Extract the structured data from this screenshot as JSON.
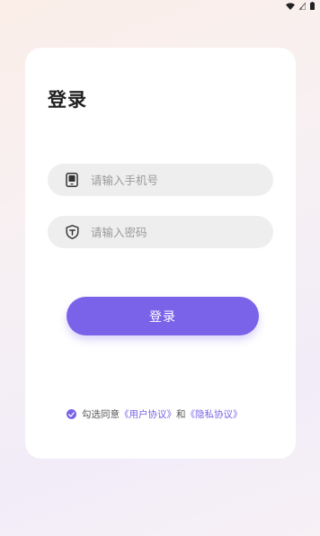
{
  "login": {
    "title": "登录",
    "phone_placeholder": "请输入手机号",
    "password_placeholder": "请输入密码",
    "submit_label": "登录"
  },
  "agreement": {
    "prefix": "勾选同意",
    "user_agreement": "《用户协议》",
    "conjunction": "和",
    "privacy_agreement": "《隐私协议》",
    "checked": true
  },
  "icons": {
    "status": [
      "wifi-icon",
      "signal-icon",
      "battery-icon"
    ],
    "phone_field": "phone-icon",
    "password_field": "shield-icon",
    "agreement": "check-circle-icon"
  },
  "colors": {
    "accent": "#7a63e8",
    "input_bg": "#eeeeee",
    "card_bg": "#ffffff"
  }
}
